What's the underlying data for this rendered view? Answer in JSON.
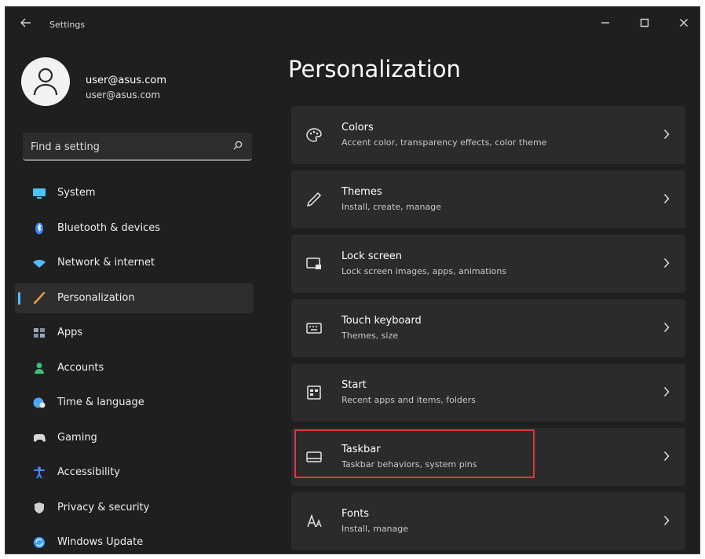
{
  "window": {
    "title": "Settings"
  },
  "user": {
    "name": "user@asus.com",
    "email": "user@asus.com"
  },
  "search": {
    "placeholder": "Find a setting"
  },
  "sidebar": {
    "items": [
      {
        "label": "System",
        "icon": "monitor-icon",
        "color": "#4cc2ff"
      },
      {
        "label": "Bluetooth & devices",
        "icon": "bluetooth-icon",
        "color": "#3a86ff"
      },
      {
        "label": "Network & internet",
        "icon": "wifi-icon",
        "color": "#56b8ff"
      },
      {
        "label": "Personalization",
        "icon": "brush-icon",
        "color": "#f0a040",
        "active": true
      },
      {
        "label": "Apps",
        "icon": "apps-icon",
        "color": "#9aa7b8"
      },
      {
        "label": "Accounts",
        "icon": "person-icon",
        "color": "#3bbf7c"
      },
      {
        "label": "Time & language",
        "icon": "globe-clock-icon",
        "color": "#4ea8ff"
      },
      {
        "label": "Gaming",
        "icon": "gamepad-icon",
        "color": "#d8d8d8"
      },
      {
        "label": "Accessibility",
        "icon": "accessibility-icon",
        "color": "#3a8cff"
      },
      {
        "label": "Privacy & security",
        "icon": "shield-icon",
        "color": "#cfcfcf"
      },
      {
        "label": "Windows Update",
        "icon": "update-icon",
        "color": "#3aa0ff"
      }
    ]
  },
  "main": {
    "title": "Personalization",
    "cards": [
      {
        "title": "Colors",
        "subtitle": "Accent color, transparency effects, color theme",
        "icon": "palette-icon"
      },
      {
        "title": "Themes",
        "subtitle": "Install, create, manage",
        "icon": "pen-icon"
      },
      {
        "title": "Lock screen",
        "subtitle": "Lock screen images, apps, animations",
        "icon": "lock-screen-icon"
      },
      {
        "title": "Touch keyboard",
        "subtitle": "Themes, size",
        "icon": "keyboard-icon"
      },
      {
        "title": "Start",
        "subtitle": "Recent apps and items, folders",
        "icon": "start-icon"
      },
      {
        "title": "Taskbar",
        "subtitle": "Taskbar behaviors, system pins",
        "icon": "taskbar-icon",
        "highlighted": true
      },
      {
        "title": "Fonts",
        "subtitle": "Install, manage",
        "icon": "fonts-icon"
      }
    ]
  },
  "colors": {
    "highlight": "#d63a3a",
    "accent": "#4cc2ff"
  }
}
